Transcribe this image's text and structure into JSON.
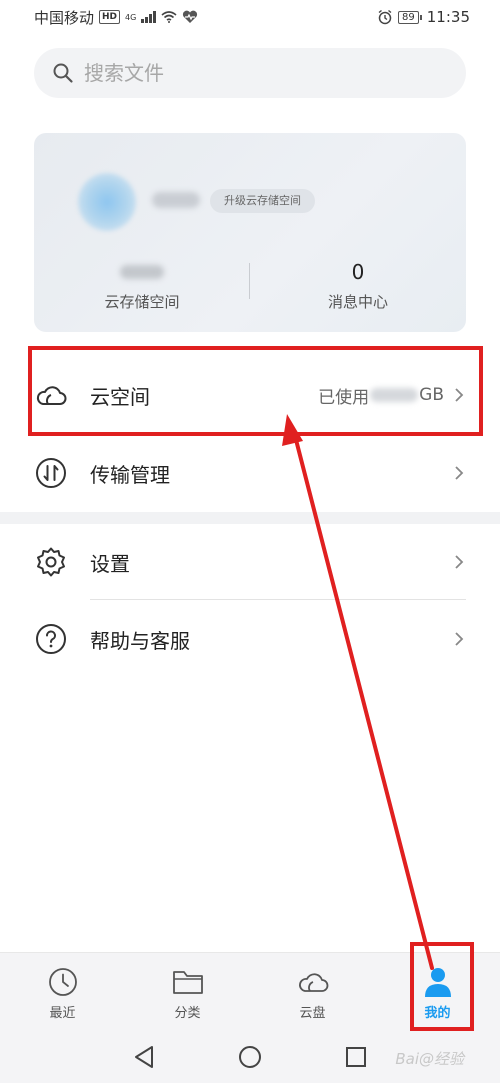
{
  "status_bar": {
    "carrier": "中国移动",
    "hd": "HD",
    "network": "4G",
    "battery": "89",
    "time": "11:35"
  },
  "search": {
    "placeholder": "搜索文件"
  },
  "account_card": {
    "upgrade_label": "升级云存储空间",
    "messages_count": "0",
    "storage_label": "云存储空间",
    "messages_label": "消息中心"
  },
  "menu": {
    "cloud_space": {
      "label": "云空间",
      "usage_prefix": "已使用",
      "usage_suffix": "GB",
      "icon": "cloud-icon"
    },
    "transfer": {
      "label": "传输管理",
      "icon": "transfer-icon"
    },
    "settings": {
      "label": "设置",
      "icon": "gear-icon"
    },
    "help": {
      "label": "帮助与客服",
      "icon": "help-icon"
    }
  },
  "bottom_nav": {
    "tabs": [
      {
        "label": "最近",
        "icon": "clock-icon"
      },
      {
        "label": "分类",
        "icon": "folder-icon"
      },
      {
        "label": "云盘",
        "icon": "cloud-icon"
      },
      {
        "label": "我的",
        "icon": "person-icon",
        "active": true
      }
    ]
  },
  "watermark": "Bai@经验",
  "colors": {
    "accent": "#1a9bf0",
    "annotation_red": "#e02020"
  }
}
